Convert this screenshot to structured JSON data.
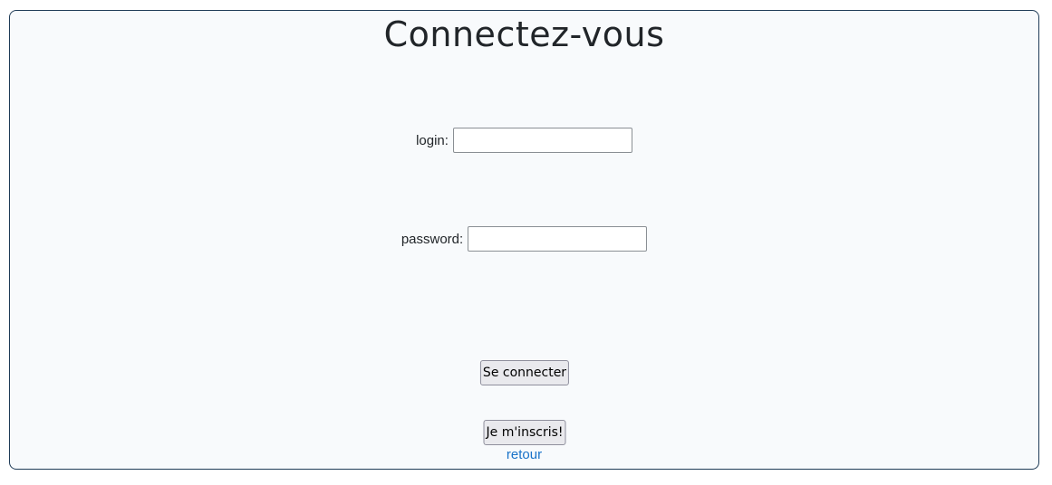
{
  "page": {
    "title": "Connectez-vous"
  },
  "form": {
    "login_label": "login:",
    "login_value": "",
    "password_label": "password:",
    "password_value": "",
    "submit_label": "Se connecter",
    "register_label": "Je m'inscris!",
    "back_link": "retour"
  },
  "colors": {
    "card_background": "#f8fafc",
    "card_border": "#1f3b57",
    "link": "#1a73c9",
    "button_background": "#e9e9ed"
  }
}
